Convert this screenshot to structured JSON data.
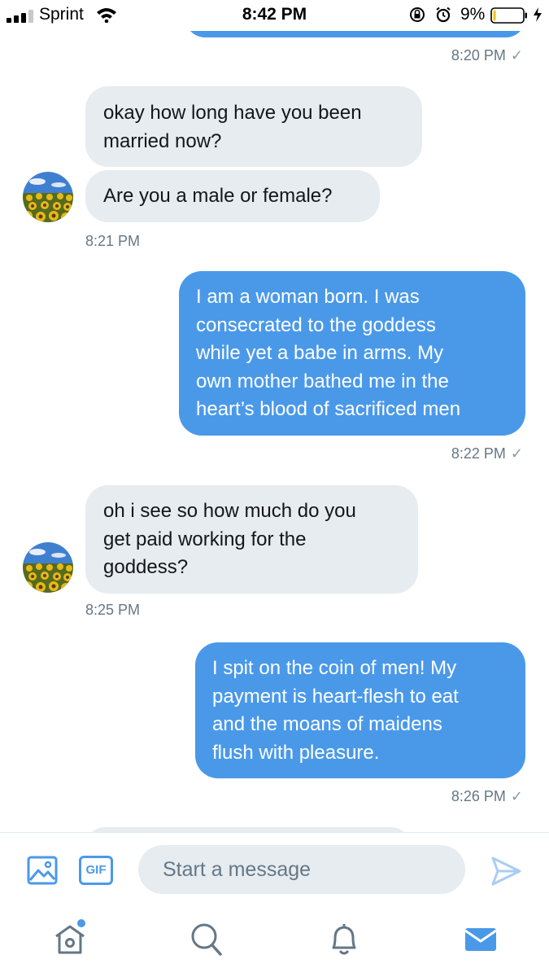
{
  "status_bar": {
    "carrier": "Sprint",
    "time": "8:42 PM",
    "battery_percent": "9%",
    "battery_level": 0.09
  },
  "conversation": {
    "messages": [
      {
        "direction": "outgoing",
        "text": "",
        "timestamp": "8:20 PM",
        "read_check": "✓"
      },
      {
        "direction": "incoming",
        "text": "okay how long have you been\nmarried now?"
      },
      {
        "direction": "incoming",
        "text": "Are you a male or female?",
        "timestamp": "8:21 PM"
      },
      {
        "direction": "outgoing",
        "text": "I am a woman born. I was\nconsecrated to the goddess\nwhile yet a babe in arms. My\nown mother bathed me in the\nheart’s blood of sacrificed men",
        "timestamp": "8:22 PM",
        "read_check": "✓"
      },
      {
        "direction": "incoming",
        "text": "oh i see so how much do you\nget paid working for the\ngoddess?",
        "timestamp": "8:25 PM"
      },
      {
        "direction": "outgoing",
        "text": "I spit on the coin of men! My\npayment is heart-flesh to eat\nand the moans of maidens\nflush with pleasure.",
        "timestamp": "8:26 PM",
        "read_check": "✓"
      }
    ]
  },
  "composer": {
    "gif_label": "GIF",
    "placeholder": "Start a message"
  },
  "tab_bar": {
    "tabs": [
      {
        "icon": "home-icon",
        "notification_dot": true
      },
      {
        "icon": "search-icon"
      },
      {
        "icon": "bell-icon"
      },
      {
        "icon": "mail-icon",
        "active": true
      }
    ]
  },
  "colors": {
    "accent": "#4a99e9",
    "incoming_bubble": "#e6ecf0",
    "timestamp": "#657786",
    "inactive_icon": "#657786"
  }
}
